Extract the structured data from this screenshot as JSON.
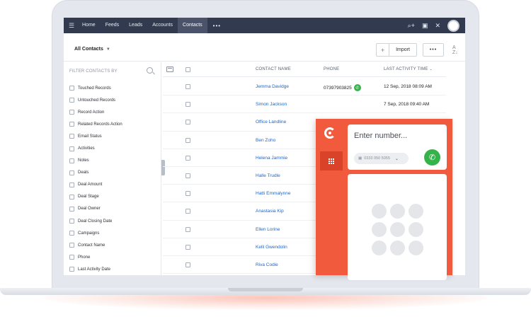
{
  "nav": {
    "items": [
      {
        "label": "Home",
        "active": false
      },
      {
        "label": "Feeds",
        "active": false
      },
      {
        "label": "Leads",
        "active": false
      },
      {
        "label": "Accounts",
        "active": false
      },
      {
        "label": "Contacts",
        "active": true
      }
    ],
    "more_label": "•••",
    "icons": [
      "menu-icon",
      "search-add-icon",
      "calendar-icon",
      "tools-icon",
      "avatar"
    ]
  },
  "toolbar": {
    "view_label": "All Contacts",
    "add_label": "+",
    "import_label": "Import",
    "more_label": "•••",
    "sort_icon": "sort-az-icon"
  },
  "sidebar": {
    "title": "FILTER CONTACTS BY",
    "filters": [
      "Touched Records",
      "Untouched Records",
      "Record Action",
      "Related Records Action",
      "Email Status",
      "Activities",
      "Notes",
      "Deals",
      "Deal Amount",
      "Deal Stage",
      "Deal Owner",
      "Deal Closing Date",
      "Campaigns",
      "Contact Name",
      "Phone",
      "Last Activity Date"
    ]
  },
  "table": {
    "headers": {
      "name": "CONTACT NAME",
      "phone": "PHONE",
      "activity": "LAST ACTIVITY TIME"
    },
    "rows": [
      {
        "name": "Jemma Davidge",
        "phone": "07397903825",
        "activity": "12 Sep, 2018 08:09 AM",
        "call": true
      },
      {
        "name": "Simon Jackson",
        "phone": "",
        "activity": "7 Sep, 2018 09:40 AM",
        "call": false
      },
      {
        "name": "Office Landline",
        "phone": "",
        "activity": "",
        "call": false
      },
      {
        "name": "Ben Zoho",
        "phone": "",
        "activity": "",
        "call": false
      },
      {
        "name": "Helena Jammie",
        "phone": "",
        "activity": "",
        "call": false
      },
      {
        "name": "Halle Trudle",
        "phone": "",
        "activity": "",
        "call": false
      },
      {
        "name": "Hatti Emmalynne",
        "phone": "",
        "activity": "",
        "call": false
      },
      {
        "name": "Anastasia Kip",
        "phone": "",
        "activity": "",
        "call": false
      },
      {
        "name": "Ellen Lorine",
        "phone": "",
        "activity": "",
        "call": false
      },
      {
        "name": "Kelli Gwendolin",
        "phone": "",
        "activity": "",
        "call": false
      },
      {
        "name": "Riva Codie",
        "phone": "",
        "activity": "",
        "call": false
      }
    ]
  },
  "dialer": {
    "placeholder": "Enter number...",
    "caller_id": "0333 050 5055",
    "accent": "#f15a3d",
    "call_color": "#34b34a"
  }
}
